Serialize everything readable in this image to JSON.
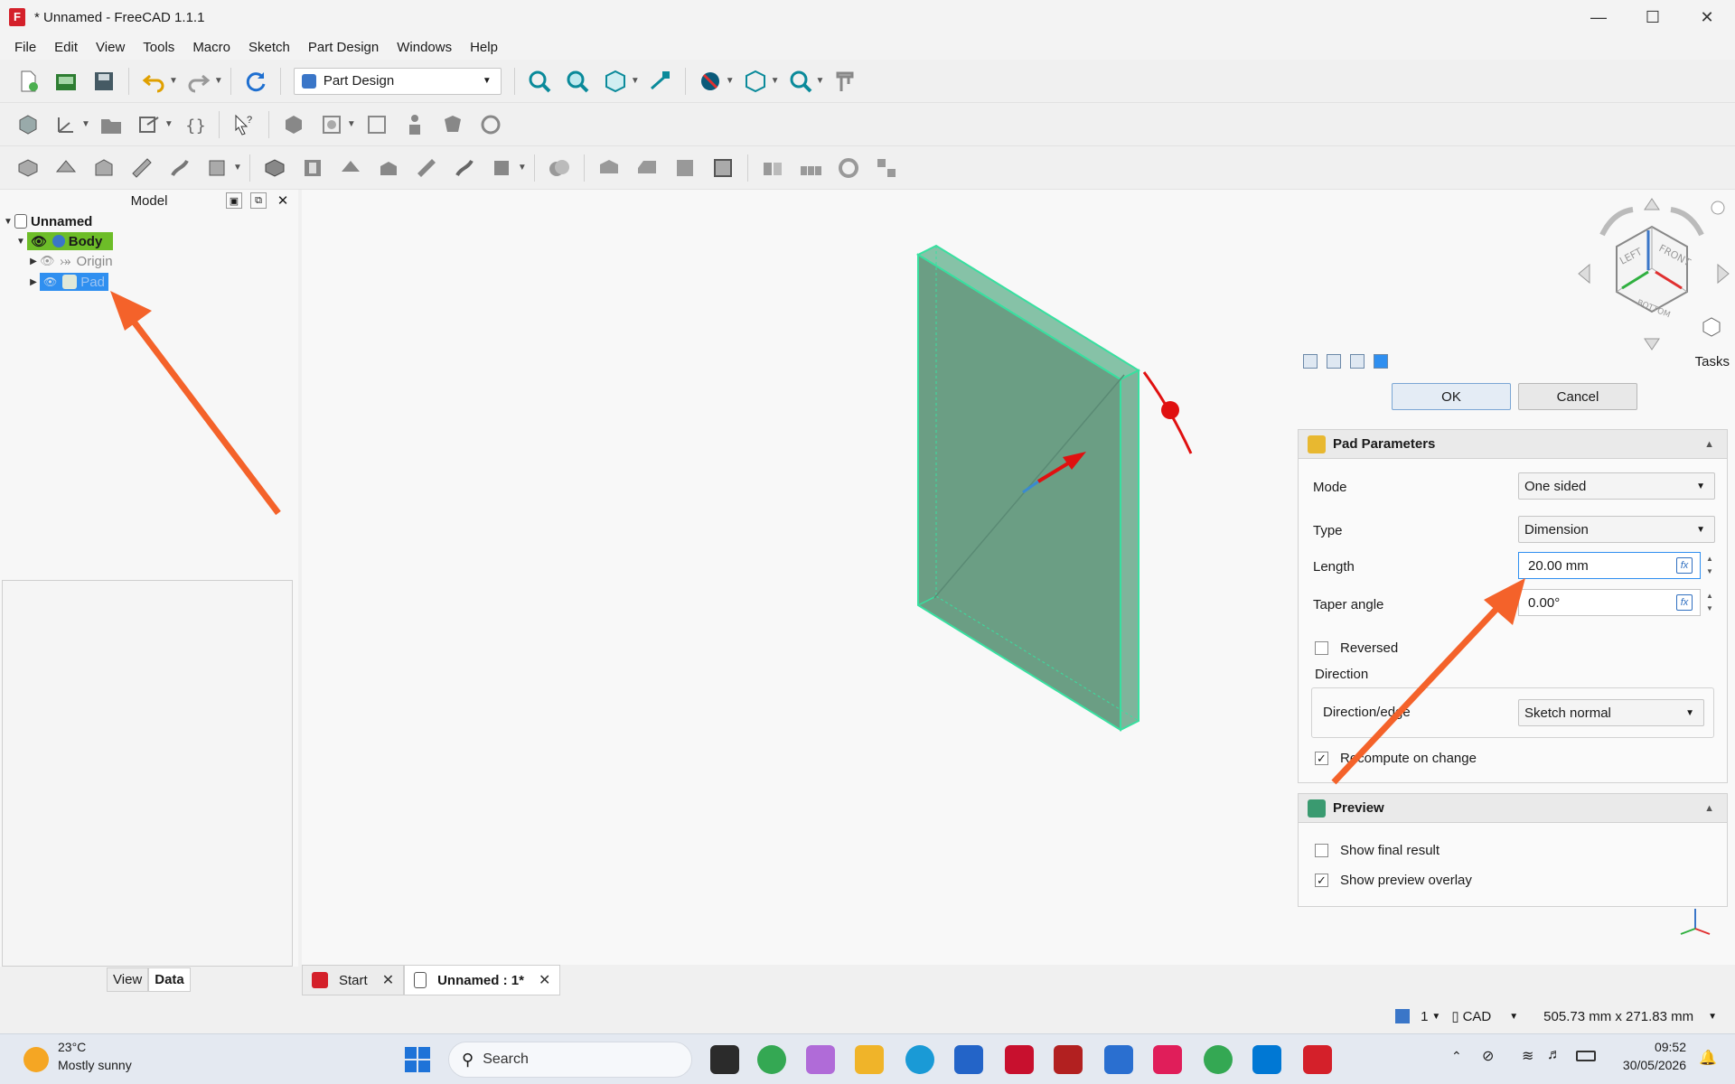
{
  "window": {
    "title": "* Unnamed - FreeCAD 1.1.1",
    "app_icon": "F"
  },
  "menu": [
    "File",
    "Edit",
    "View",
    "Tools",
    "Macro",
    "Sketch",
    "Part Design",
    "Windows",
    "Help"
  ],
  "workbench": {
    "selected": "Part Design"
  },
  "model_panel": {
    "title": "Model",
    "tree": {
      "document": "Unnamed",
      "body": "Body",
      "origin": "Origin",
      "pad": "Pad"
    }
  },
  "property_tabs": {
    "view": "View",
    "data": "Data"
  },
  "navcube": {
    "left": "LEFT",
    "front": "FRONT",
    "bottom": "BOTTOM"
  },
  "task_panel": {
    "label": "Tasks",
    "ok": "OK",
    "cancel": "Cancel",
    "pad_params": {
      "title": "Pad Parameters",
      "mode_label": "Mode",
      "mode_value": "One sided",
      "type_label": "Type",
      "type_value": "Dimension",
      "length_label": "Length",
      "length_value": "20.00 mm",
      "taper_label": "Taper angle",
      "taper_value": "0.00°",
      "reversed_label": "Reversed",
      "reversed_checked": false,
      "direction_title": "Direction",
      "direction_edge_label": "Direction/edge",
      "direction_edge_value": "Sketch normal",
      "recompute_label": "Recompute on change",
      "recompute_checked": true
    },
    "preview": {
      "title": "Preview",
      "show_final_label": "Show final result",
      "show_final_checked": false,
      "show_overlay_label": "Show preview overlay",
      "show_overlay_checked": true
    }
  },
  "doc_tabs": [
    {
      "label": "Start"
    },
    {
      "label": "Unnamed : 1*"
    }
  ],
  "statusbar": {
    "page": "1",
    "nav_style": "CAD",
    "dimensions": "505.73 mm x 271.83 mm"
  },
  "taskbar": {
    "weather_temp": "23°C",
    "weather_desc": "Mostly sunny",
    "search_placeholder": "Search",
    "time": "09:52",
    "date": "30/05/2026"
  },
  "colors": {
    "accent": "#2f8ff0",
    "body_highlight": "#6dbd28",
    "annotation_arrow": "#f4622a",
    "solid_face": "#6b9e84",
    "solid_edge": "#38e0a0"
  }
}
